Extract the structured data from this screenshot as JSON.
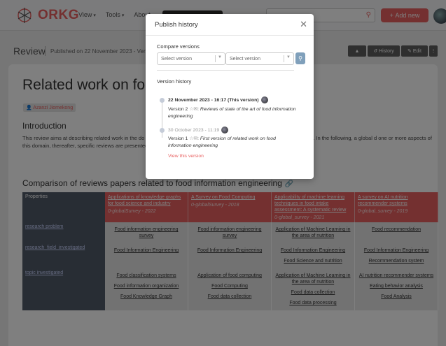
{
  "app": {
    "name": "ORKG"
  },
  "nav": {
    "menu": [
      "View",
      "Tools",
      "About"
    ],
    "add_new": "Add new"
  },
  "review": {
    "label": "Review",
    "published": "Published on 22 November 2023 - Version",
    "buttons": [
      "History",
      "Edit"
    ]
  },
  "doc": {
    "title": "Related work on food",
    "author": "Azanzi Jiomekong",
    "intro_heading": "Introduction",
    "intro_text": "This review aims at describing related work in the do                                                                         of reviews papers describing any aspect of food information engineering. In the following, a global d                                                                     one or more aspects of this domain, thereafter, specific reviews are presented (e.g., review of food re",
    "comparison_heading": "Comparison of reviews papers related to food information engineering"
  },
  "table": {
    "properties_label": "Properties",
    "papers": [
      {
        "title": "Applications of knowledge graphs for food science and industry",
        "meta": "0-globalSurvey - 2022"
      },
      {
        "title": "A Survey on Food Computing",
        "meta": "0-globalSurvey - 2018"
      },
      {
        "title": "Applicability of machine learning techniques in food intake assessment: A systematic review",
        "meta": "0-global_survey - 2021"
      },
      {
        "title": "A survey on AI nutrition recommender systems",
        "meta": "0-global_survey - 2019"
      }
    ],
    "rows": [
      {
        "property": "research problem",
        "cells": [
          [
            "Food information engineering survey"
          ],
          [
            "Food information engineering survey"
          ],
          [
            "Application of Machine Learning in the area of nutrition"
          ],
          [
            "Food recommendation"
          ]
        ]
      },
      {
        "property": "research_field_investigated",
        "cells": [
          [
            "Food Information Engineering"
          ],
          [
            "Food Information Engineering"
          ],
          [
            "Food Information Engineering",
            "Food Science and nutrition"
          ],
          [
            "Food Information Engineering",
            "Recommendation system"
          ]
        ]
      },
      {
        "property": "topic investigated",
        "cells": [
          [
            "Food classification systems",
            "Food information organization",
            "Food Knowledge Graph"
          ],
          [
            "Application of food computing",
            "Food Computing",
            "Food data collection"
          ],
          [
            "Application of Machine Learning in the area of nutrition",
            "Food data collection",
            "Food data processing"
          ],
          [
            "AI nutrition recommender systems",
            "Eating behavior analysis",
            "Food Analysis"
          ]
        ]
      }
    ]
  },
  "modal": {
    "title": "Publish history",
    "compare_label": "Compare versions",
    "select_placeholder_1": "Select version",
    "select_placeholder_2": "Select version",
    "history_label": "Version history",
    "versions": [
      {
        "date": "22 November 2023 - 16:17 (This version)",
        "version": "Version 2",
        "description": "Reviews of state of the art of food information engineering"
      },
      {
        "date": "30 October 2023 - 11:19",
        "version": "Version 1",
        "description": "First version of related work on food information engineering",
        "view_link": "View this version"
      }
    ]
  },
  "colors": {
    "accent": "#e86161",
    "property_col": "#505a68",
    "overlay": "rgba(0,0,0,0.5)"
  }
}
